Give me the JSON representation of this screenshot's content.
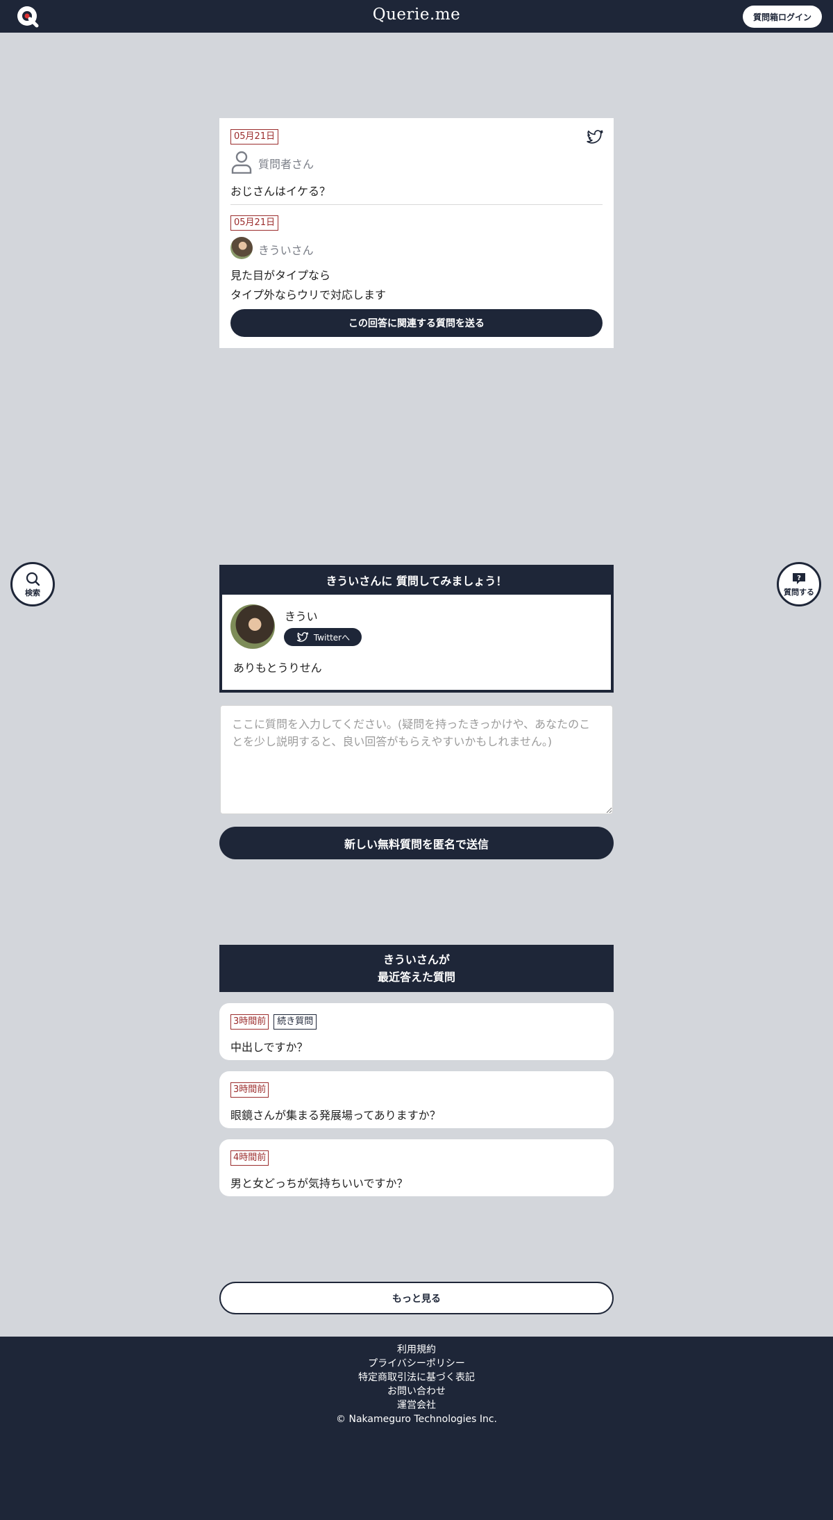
{
  "header": {
    "brand": "Querie.me",
    "login_label": "質問箱ログイン"
  },
  "qa": {
    "question_date": "05月21日",
    "asker_name": "質問者さん",
    "question_text": "おじさんはイケる？",
    "answer_date": "05月21日",
    "answerer_name": "きういさん",
    "answer_line1": "見た目がタイプなら",
    "answer_line2": "タイプ外ならウリで対応します",
    "related_button": "この回答に関連する質問を送る"
  },
  "floating": {
    "search_label": "検索",
    "ask_label": "質問する"
  },
  "profile": {
    "heading": "きういさんに 質問してみましょう！",
    "name": "きうい",
    "twitter_label": "Twitterへ",
    "bio": "ありもとうりせん"
  },
  "form": {
    "placeholder": "ここに質問を入力してください。(疑問を持ったきっかけや、あなたのことを少し説明すると、良い回答がもらえやすいかもしれません。)",
    "send_label": "新しい無料質問を匿名で送信"
  },
  "recent": {
    "heading_line1": "きういさんが",
    "heading_line2": "最近答えた質問",
    "items": [
      {
        "time": "3時間前",
        "tag": "続き質問",
        "text": "中出しですか？"
      },
      {
        "time": "3時間前",
        "text": "眼鏡さんが集まる発展場ってありますか？"
      },
      {
        "time": "4時間前",
        "text": "男と女どっちが気持ちいいですか？"
      }
    ],
    "more_label": "もっと見る"
  },
  "footer": {
    "links": [
      "利用規約",
      "プライバシーポリシー",
      "特定商取引法に基づく表記",
      "お問い合わせ",
      "運営会社"
    ],
    "copyright": "© Nakameguro Technologies Inc."
  },
  "colors": {
    "navy": "#1e2638",
    "background": "#d3d6db",
    "date_red": "#9b2c2c"
  },
  "icons": [
    "logo-icon",
    "twitter-icon",
    "person-icon",
    "search-icon",
    "question-bubble-icon"
  ]
}
